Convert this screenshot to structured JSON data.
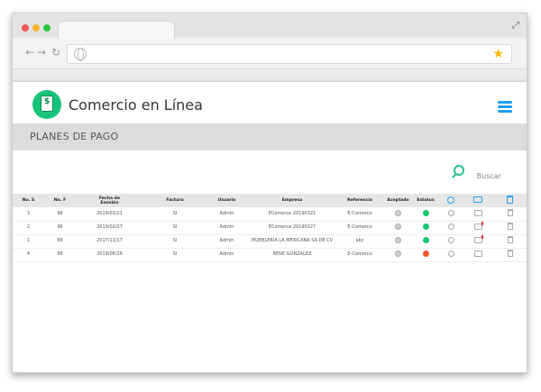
{
  "app": {
    "title": "Comercio en Línea",
    "section_title": "PLANES DE PAGO"
  },
  "search": {
    "label": "Buscar",
    "icon": "search-icon"
  },
  "colors": {
    "brand_green": "#18c47a",
    "accent_blue": "#1ea0f0",
    "status_green": "#16c96e",
    "status_red": "#f25a2a"
  },
  "table": {
    "headers": {
      "no_s": "No. S",
      "no_f": "No. F",
      "fecha": "Fecha de\nEmisión",
      "factura": "Factura",
      "usuario": "Usuario",
      "empresa": "Empresa",
      "referencia": "Referencia",
      "aceptado": "Aceptado",
      "estatus": "Estatus"
    },
    "rows": [
      {
        "no_s": "3",
        "no_f": "98",
        "fecha": "2019/03/21",
        "factura": "SI",
        "usuario": "Admin",
        "empresa": "EComerce 20190321",
        "referencia": "E-Comerco",
        "status": "green",
        "mail_flag": false
      },
      {
        "no_s": "2",
        "no_f": "96",
        "fecha": "2019/02/27",
        "factura": "SI",
        "usuario": "Admin",
        "empresa": "EComerce 20190227",
        "referencia": "E-Comerco",
        "status": "green",
        "mail_flag": true
      },
      {
        "no_s": "1",
        "no_f": "66",
        "fecha": "2017/11/17",
        "factura": "SI",
        "usuario": "Admin",
        "empresa": "MUEBLERIA LA MEXICANA SA DE CV",
        "referencia": "abc",
        "status": "green",
        "mail_flag": true
      },
      {
        "no_s": "4",
        "no_f": "99",
        "fecha": "2019/06/26",
        "factura": "SI",
        "usuario": "Admin",
        "empresa": "RENE GONZALEZ",
        "referencia": "E-Comerco",
        "status": "red",
        "mail_flag": false
      }
    ]
  }
}
